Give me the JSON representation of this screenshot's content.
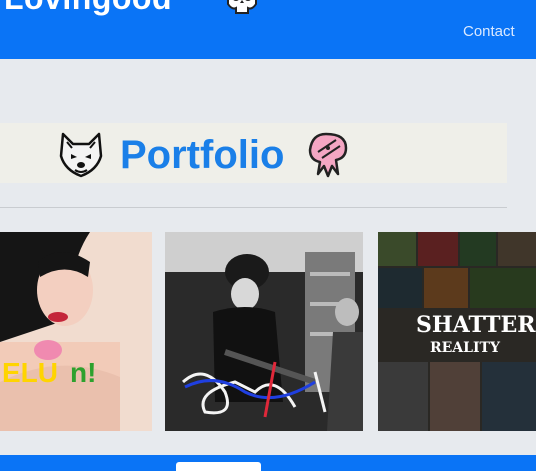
{
  "header": {
    "brand": "Lovingood",
    "nav": {
      "contact": "Contact"
    },
    "brand_icon": "skull-icon"
  },
  "section": {
    "title": "Portfolio",
    "left_icon": "wolf-icon",
    "right_icon": "squid-icon"
  },
  "gallery": {
    "items": [
      {
        "caption_art": "ELUn!"
      },
      {
        "caption_art": "ZOA"
      },
      {
        "caption_art": "SHATTERED REALITY"
      }
    ]
  },
  "colors": {
    "header_bg": "#0a74f6",
    "title": "#1a7fe8",
    "page_bg": "#e7eaee",
    "banner_bg": "#efefe9"
  }
}
